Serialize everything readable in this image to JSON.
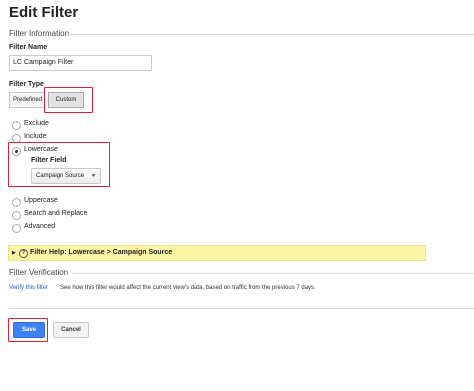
{
  "page": {
    "title": "Edit Filter"
  },
  "filter_information": {
    "section_title": "Filter Information",
    "name_label": "Filter Name",
    "name_value": "LC Campaign Filter",
    "type_label": "Filter Type",
    "type_options": [
      "Predefined",
      "Custom"
    ],
    "type_selected": "Custom",
    "options": [
      {
        "label": "Exclude",
        "selected": false
      },
      {
        "label": "Include",
        "selected": false
      },
      {
        "label": "Lowercase",
        "selected": true
      },
      {
        "label": "Uppercase",
        "selected": false
      },
      {
        "label": "Search and Replace",
        "selected": false
      },
      {
        "label": "Advanced",
        "selected": false
      }
    ],
    "field_label": "Filter Field",
    "field_value": "Campaign Source",
    "help_text": "Filter Help: Lowercase > Campaign Source"
  },
  "filter_verification": {
    "section_title": "Filter Verification",
    "link_text": "Verify this filter",
    "description": "See how this filter would affect the current view's data, based on traffic from the previous 7 days."
  },
  "actions": {
    "save_label": "Save",
    "cancel_label": "Cancel"
  },
  "colors": {
    "highlight": "#d8233b",
    "primary_button": "#3d82f0",
    "help_background": "#fdf5a6",
    "link": "#1a5ec4"
  },
  "icons": {
    "help": "help-question-icon",
    "dropdown": "chevron-down-icon",
    "expand": "triangle-right-icon"
  }
}
